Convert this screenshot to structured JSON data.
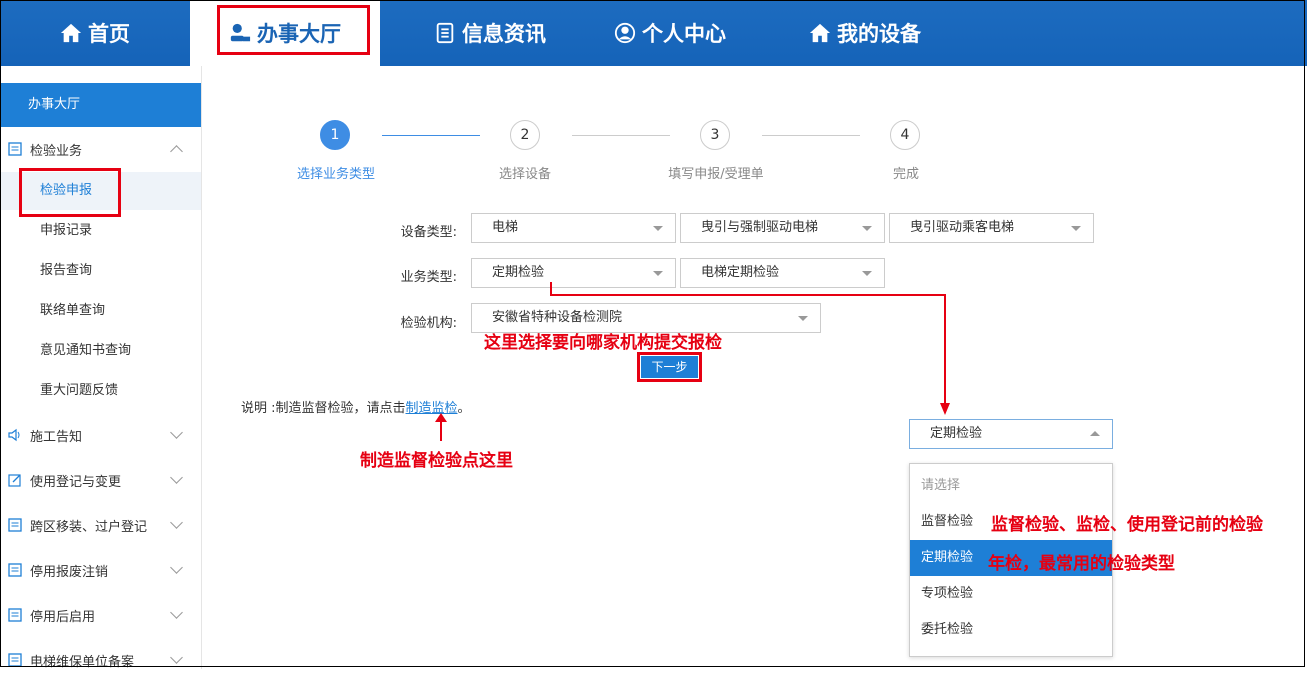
{
  "nav": {
    "items": [
      {
        "label": "首页",
        "icon": "home-icon"
      },
      {
        "label": "办事大厅",
        "icon": "user-seal-icon"
      },
      {
        "label": "信息资讯",
        "icon": "document-icon"
      },
      {
        "label": "个人中心",
        "icon": "person-circle-icon"
      },
      {
        "label": "我的设备",
        "icon": "home-icon"
      }
    ]
  },
  "sidebar": {
    "header": "办事大厅",
    "group1": "检验业务",
    "subitems": [
      "检验申报",
      "申报记录",
      "报告查询",
      "联络单查询",
      "意见通知书查询",
      "重大问题反馈"
    ],
    "groups": [
      "施工告知",
      "使用登记与变更",
      "跨区移装、过户登记",
      "停用报废注销",
      "停用后启用",
      "电梯维保单位备案"
    ]
  },
  "steps": [
    {
      "num": "1",
      "label": "选择业务类型"
    },
    {
      "num": "2",
      "label": "选择设备"
    },
    {
      "num": "3",
      "label": "填写申报/受理单"
    },
    {
      "num": "4",
      "label": "完成"
    }
  ],
  "form": {
    "device_type_label": "设备类型:",
    "device_type": [
      "电梯",
      "曳引与强制驱动电梯",
      "曳引驱动乘客电梯"
    ],
    "business_type_label": "业务类型:",
    "business_type": [
      "定期检验",
      "电梯定期检验"
    ],
    "agency_label": "检验机构:",
    "agency": "安徽省特种设备检测院",
    "next_button": "下一步"
  },
  "note": {
    "prefix": "说明 :制造监督检验，请点击",
    "link": "制造监检",
    "suffix": "。"
  },
  "dropdown": {
    "selected": "定期检验",
    "options": [
      "请选择",
      "监督检验",
      "定期检验",
      "专项检验",
      "委托检验"
    ]
  },
  "annotations": {
    "agency": "这里选择要向哪家机构提交报检",
    "manufacture": "制造监督检验点这里",
    "supervise": "监督检验、监检、使用登记前的检验",
    "periodic": "年检，最常用的检验类型"
  },
  "colors": {
    "nav_bg": "#1563b8",
    "accent": "#1e7fd6",
    "annotation_red": "#e60012"
  }
}
